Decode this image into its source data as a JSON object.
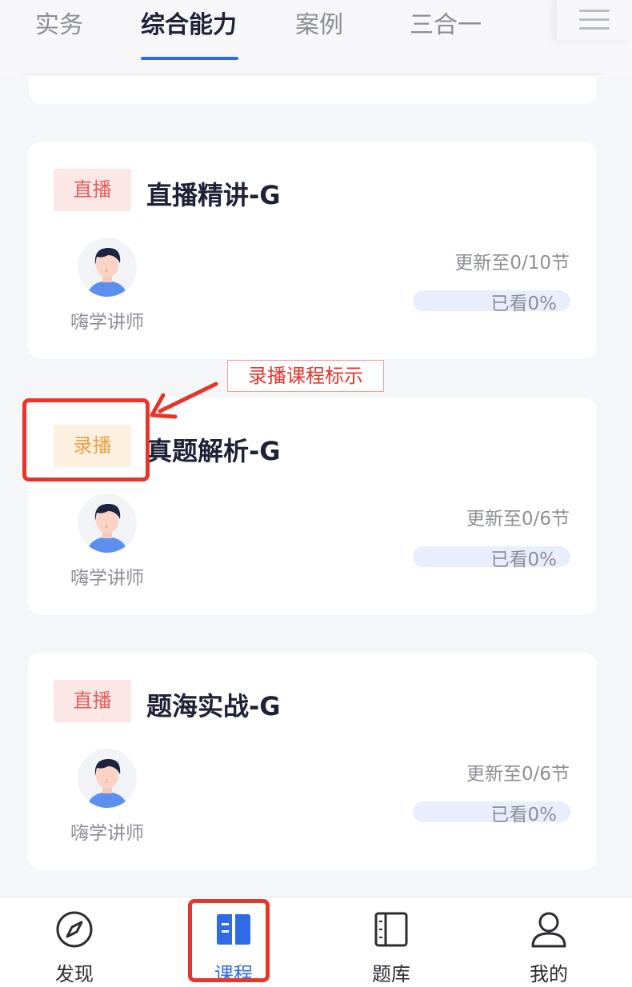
{
  "tabs": [
    {
      "label": "实务",
      "active": false
    },
    {
      "label": "综合能力",
      "active": true
    },
    {
      "label": "案例",
      "active": false
    },
    {
      "label": "三合一",
      "active": false
    }
  ],
  "courses": [
    {
      "badge": "直播",
      "badge_type": "live",
      "title": "直播精讲-G",
      "teacher": "嗨学讲师",
      "update": "更新至0/10节",
      "progress_label": "已看0%",
      "progress": 0
    },
    {
      "badge": "录播",
      "badge_type": "recorded",
      "title": "真题解析-G",
      "teacher": "嗨学讲师",
      "update": "更新至0/6节",
      "progress_label": "已看0%",
      "progress": 0
    },
    {
      "badge": "直播",
      "badge_type": "live",
      "title": "题海实战-G",
      "teacher": "嗨学讲师",
      "update": "更新至0/6节",
      "progress_label": "已看0%",
      "progress": 0
    }
  ],
  "annotation": {
    "label": "录播课程标示"
  },
  "bottom_nav": [
    {
      "label": "发现",
      "icon": "compass-icon",
      "active": false
    },
    {
      "label": "课程",
      "icon": "book-icon",
      "active": true
    },
    {
      "label": "题库",
      "icon": "notebook-icon",
      "active": false
    },
    {
      "label": "我的",
      "icon": "user-icon",
      "active": false
    }
  ],
  "colors": {
    "accent": "#2f6be6",
    "live_badge": "#e0605a",
    "recorded_badge": "#eba14a",
    "annotation": "#e6352b"
  }
}
